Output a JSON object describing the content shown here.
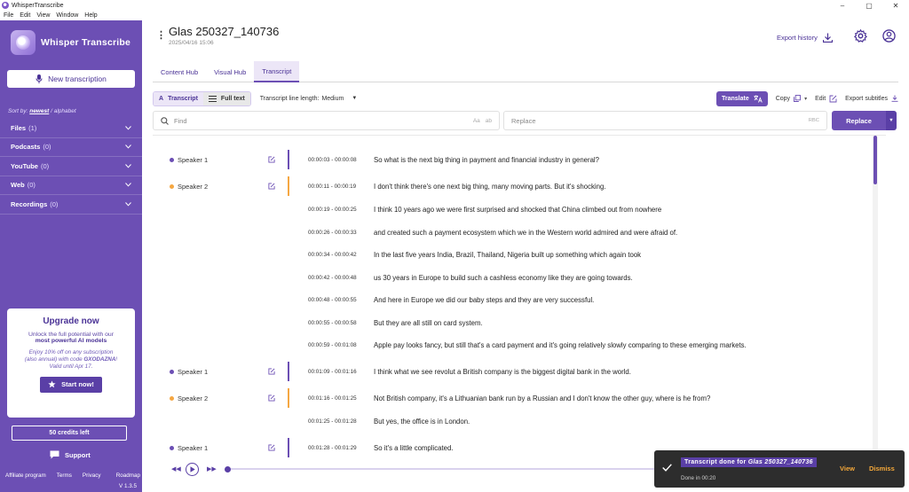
{
  "window": {
    "title": "WhisperTranscribe",
    "controls": [
      "–",
      "▢",
      "✕"
    ]
  },
  "menu": [
    "File",
    "Edit",
    "View",
    "Window",
    "Help"
  ],
  "sidebar": {
    "brand": "Whisper Transcribe",
    "new_transcription": "New transcription",
    "sort_label": "Sort by:",
    "sort_newest": "newest",
    "sort_sep": "/",
    "sort_alpha": "alphabet",
    "folders": [
      {
        "name": "Files",
        "count": "(1)"
      },
      {
        "name": "Podcasts",
        "count": "(0)"
      },
      {
        "name": "YouTube",
        "count": "(0)"
      },
      {
        "name": "Web",
        "count": "(0)"
      },
      {
        "name": "Recordings",
        "count": "(0)"
      }
    ],
    "upgrade": {
      "title": "Upgrade now",
      "line1": "Unlock the full potential with our",
      "line2": "most powerful AI models",
      "promo1": "Enjoy 10% off on any subscription",
      "promo2": "(also annual) with code",
      "code": "GXODAZNA",
      "promo3": "!",
      "promo4": "Valid until Apr 17.",
      "button": "Start now!"
    },
    "credits": "50 credits left",
    "support": "Support",
    "footer": [
      "Affiliate program",
      "Terms",
      "Privacy",
      "Roadmap"
    ],
    "version": "V 1.3.5"
  },
  "header": {
    "title": "Glas 250327_140736",
    "date": "2025/04/16 15:06",
    "export_history": "Export history"
  },
  "tabs": [
    "Content Hub",
    "Visual Hub",
    "Transcript"
  ],
  "toolbar": {
    "transcript": "Transcript",
    "full_text": "Full text",
    "line_length_label": "Transcript line length:",
    "line_length_value": "Medium",
    "translate": "Translate",
    "copy": "Copy",
    "edit": "Edit",
    "export_subtitles": "Export subtitles"
  },
  "search": {
    "find_placeholder": "Find",
    "aa": "Aa",
    "replace_placeholder": "Replace",
    "rbc": "RBC",
    "replace_button": "Replace"
  },
  "colors": {
    "accent": "#6c4fb4",
    "speaker1": "#6c4fb4",
    "speaker2": "#f5a742"
  },
  "transcript": [
    {
      "speaker": "Speaker 1",
      "color": "#6c4fb4",
      "time": "00:00:03 - 00:00:08",
      "text": "So what is the next big thing in payment and financial industry in general?"
    },
    {
      "speaker": "Speaker 2",
      "color": "#f5a742",
      "time": "00:00:11 - 00:00:19",
      "text": "I don't think there's one next big thing, many moving parts. But it's shocking."
    },
    {
      "speaker": "",
      "color": "",
      "time": "00:00:19 - 00:00:25",
      "text": "I think 10 years ago we were first surprised and shocked that China climbed out from nowhere"
    },
    {
      "speaker": "",
      "color": "",
      "time": "00:00:26 - 00:00:33",
      "text": "and created such a payment ecosystem which we in the Western world admired and were afraid of."
    },
    {
      "speaker": "",
      "color": "",
      "time": "00:00:34 - 00:00:42",
      "text": "In the last five years India, Brazil, Thailand, Nigeria built up something which again took"
    },
    {
      "speaker": "",
      "color": "",
      "time": "00:00:42 - 00:00:48",
      "text": "us 30 years in Europe to build such a cashless economy like they are going towards."
    },
    {
      "speaker": "",
      "color": "",
      "time": "00:00:48 - 00:00:55",
      "text": "And here in Europe we did our baby steps and they are very successful."
    },
    {
      "speaker": "",
      "color": "",
      "time": "00:00:55 - 00:00:58",
      "text": "But they are all still on card system."
    },
    {
      "speaker": "",
      "color": "",
      "time": "00:00:59 - 00:01:08",
      "text": "Apple pay looks fancy, but still that's a card payment and it's going relatively slowly comparing to these emerging markets."
    },
    {
      "speaker": "Speaker 1",
      "color": "#6c4fb4",
      "time": "00:01:09 - 00:01:16",
      "text": "I think what we see revolut a British company is the biggest digital bank in the world."
    },
    {
      "speaker": "Speaker 2",
      "color": "#f5a742",
      "time": "00:01:16 - 00:01:25",
      "text": "Not British company, it's a Lithuanian bank run by a Russian and I don't know the other guy, where is he from?"
    },
    {
      "speaker": "",
      "color": "",
      "time": "00:01:25 - 00:01:28",
      "text": "But yes, the office is in London."
    },
    {
      "speaker": "Speaker 1",
      "color": "#6c4fb4",
      "time": "00:01:28 - 00:01:29",
      "text": "So it's a little complicated."
    }
  ],
  "toast": {
    "title_prefix": "Transcript done for",
    "title_name": "Glas 250327_140736",
    "subtitle": "Done in 00:20",
    "view": "View",
    "dismiss": "Dismiss"
  }
}
